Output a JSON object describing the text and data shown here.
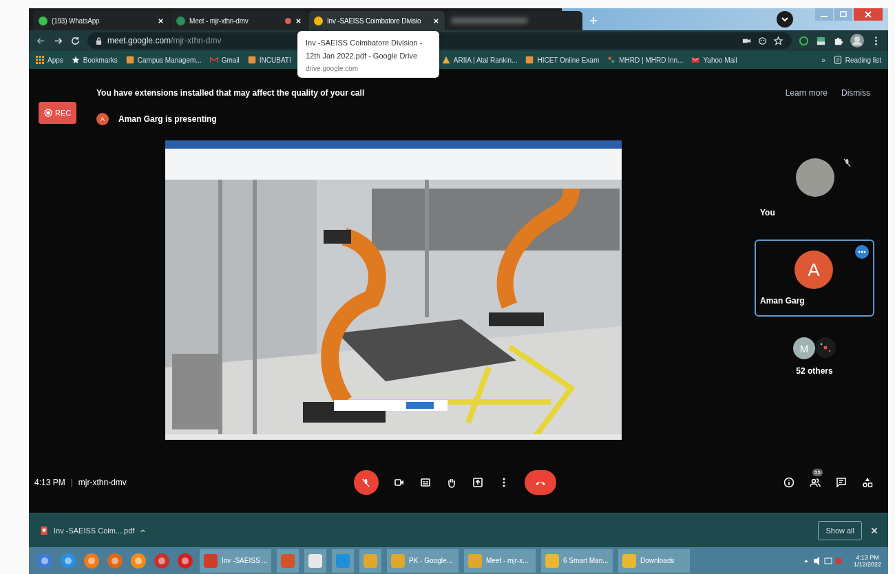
{
  "tabs": [
    {
      "label": "(193) WhatsApp",
      "selected": false,
      "recording": false
    },
    {
      "label": "Meet - mjr-xthn-dmv",
      "selected": false,
      "recording": true
    },
    {
      "label": "Inv -SAEISS Coimbatore Divisio",
      "selected": true,
      "recording": false
    },
    {
      "selected": false,
      "recording": false
    }
  ],
  "tab_tooltip": {
    "title": "Inv -SAEISS Coimbatore Division - 12th Jan 2022.pdf - Google Drive",
    "url": "drive.google.com"
  },
  "address_bar": {
    "url_host": "meet.google.com",
    "url_path": "/mjr-xthn-dmv"
  },
  "bookmarks": [
    {
      "label": "Apps"
    },
    {
      "label": "Bookmarks"
    },
    {
      "label": "Campus Managem..."
    },
    {
      "label": "Gmail"
    },
    {
      "label": "INCUBATI"
    },
    {
      "label": "ARIIA | Atal Rankin..."
    },
    {
      "label": "HICET Online Exam"
    },
    {
      "label": "MHRD | MHRD Inn..."
    },
    {
      "label": "Yahoo Mail"
    }
  ],
  "bookmarks_more": "»",
  "reading_list": "Reading list",
  "banner": {
    "text": "You have extensions installed that may affect the quality of your call",
    "links": [
      "Learn more",
      "Dismiss"
    ]
  },
  "recording": {
    "label": "REC",
    "on": true
  },
  "presenter": {
    "initial": "A",
    "text": "Aman Garg is presenting"
  },
  "participants": [
    {
      "name": "You",
      "kind": "photo",
      "selected": false,
      "muted": true
    },
    {
      "name": "Aman Garg",
      "kind": "initial",
      "initial": "A",
      "selected": true,
      "muted": false
    }
  ],
  "others": {
    "initial": "M",
    "label": "52 others"
  },
  "meeting_bar": {
    "time": "4:13 PM",
    "separator": "|",
    "code": "mjr-xthn-dmv",
    "mic_muted": true,
    "controls": [
      {
        "kind": "camera"
      },
      {
        "kind": "captions"
      },
      {
        "kind": "hand"
      },
      {
        "kind": "present"
      },
      {
        "kind": "more"
      },
      {
        "kind": "end"
      }
    ],
    "side": [
      {
        "kind": "info"
      },
      {
        "kind": "people",
        "badge": "55"
      },
      {
        "kind": "chat"
      },
      {
        "kind": "activities"
      }
    ]
  },
  "download": {
    "file": "Inv -SAEISS  Coim....pdf",
    "show_all": "Show all"
  },
  "taskbar": {
    "apps": [
      {
        "label": "Inv -SAEISS ..."
      },
      {
        "label": "PK - Google..."
      },
      {
        "label": "Meet - mjr-x..."
      },
      {
        "label": "6 Smart Man..."
      },
      {
        "label": "Downloads"
      }
    ],
    "time": "4:13 PM",
    "date": "1/12/2022"
  }
}
